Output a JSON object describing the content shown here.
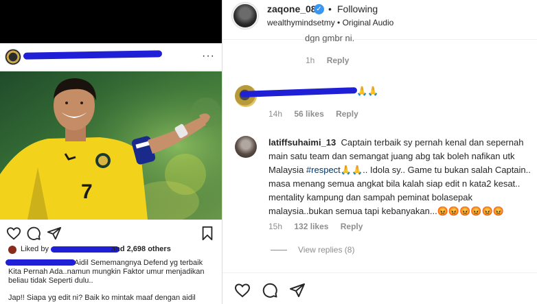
{
  "post": {
    "liked_by_prefix": "Liked by",
    "liked_by_suffix": "and 2,698 others",
    "caption_line1": "Aidil Sememangnya Defend yg terbaik",
    "caption_line2": "Kita Pernah Ada..namun mungkin Faktor umur menjadikan",
    "caption_line3": "beliau tidak Seperti dulu..",
    "caption_footer": "Jap!! Siapa yg edit ni?  Baik ko mintak maaf dengan aidil",
    "more_glyph": "···",
    "jersey_number": "7"
  },
  "reel": {
    "username": "zaqone_08",
    "verified_glyph": "✓",
    "separator": "•",
    "follow_state": "Following",
    "audio_label": "wealthymindsetmy • Original Audio"
  },
  "comments": [
    {
      "partial_text": "dgn gmbr ni.",
      "time": "1h",
      "reply_label": "Reply"
    },
    {
      "text_suffix": "🙏🙏",
      "time": "14h",
      "likes": "56 likes",
      "reply_label": "Reply"
    },
    {
      "username": "latiffsuhaimi_13",
      "line1": "Captain terbaik sy pernah kenal dan sepernah",
      "line2": "main satu team dan semangat juang abg tak boleh nafikan utk",
      "line3_before": "Malaysia ",
      "hashtag": "#respect🙏🙏",
      "line3_after": ".. Idola sy.. Game tu bukan salah Captain..",
      "line4": "masa menang semua angkat bila kalah siap edit n kata2 kesat..",
      "line5": "mentality kampung dan sampah peminat bolasepak",
      "line6": "malaysia..bukan semua tapi kebanyakan...😡😡😡😡😡😡",
      "time": "15h",
      "likes": "132 likes",
      "reply_label": "Reply",
      "view_replies": "View replies (8)"
    }
  ],
  "colors": {
    "redaction": "#1f1fd6",
    "verified": "#3897f0",
    "jersey": "#f3d21c"
  }
}
